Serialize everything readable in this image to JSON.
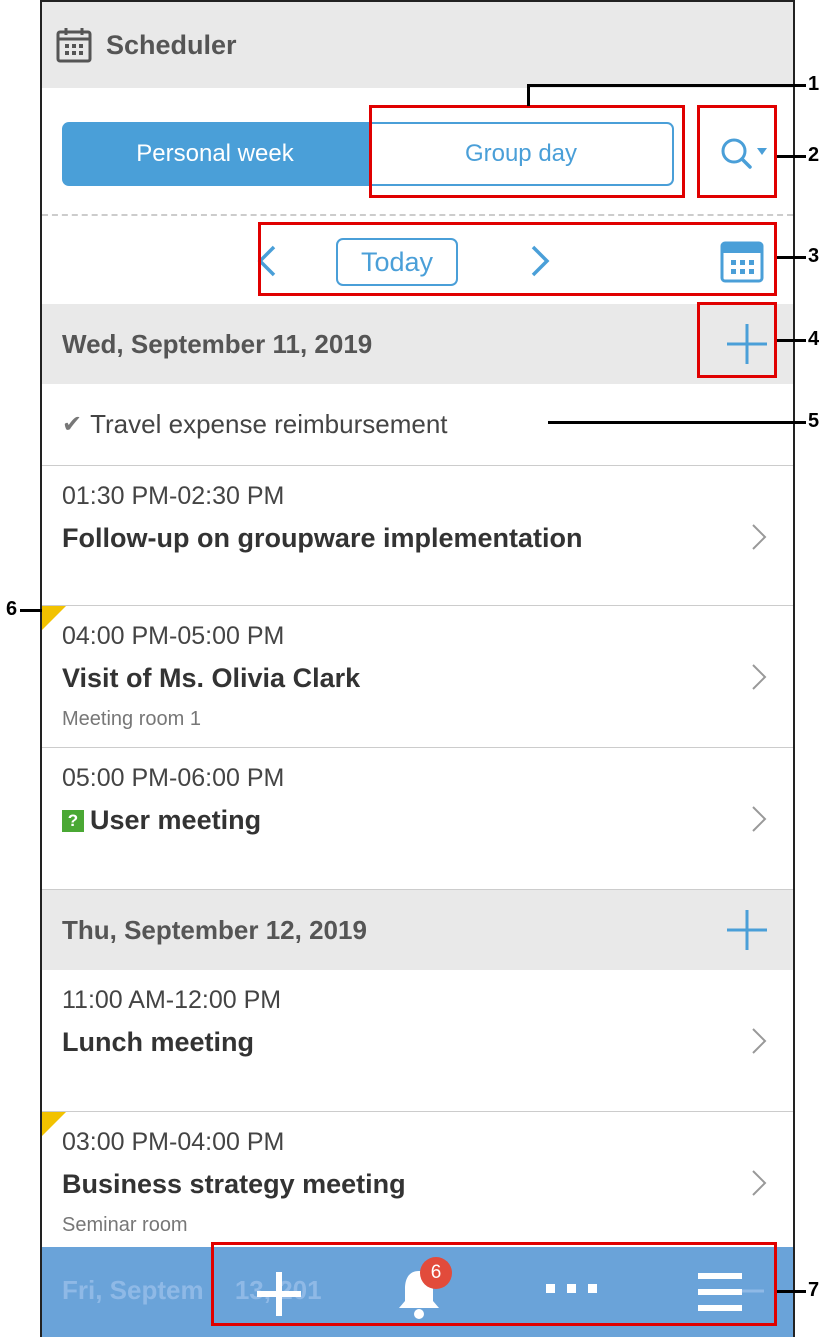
{
  "header": {
    "title": "Scheduler",
    "icon": "calendar-icon"
  },
  "tabs": {
    "personal_week": "Personal week",
    "group_day": "Group day"
  },
  "nav": {
    "today": "Today"
  },
  "days": [
    {
      "date": "Wed, September 11, 2019",
      "todo": "Travel expense reimbursement",
      "events": [
        {
          "time": "01:30 PM-02:30 PM",
          "title": "Follow-up on groupware implementation",
          "location": ""
        },
        {
          "time": "04:00 PM-05:00 PM",
          "title": "Visit of Ms. Olivia Clark",
          "location": "Meeting room 1"
        },
        {
          "time": "05:00 PM-06:00 PM",
          "title": "User meeting",
          "location": "",
          "tentative_mark": "?"
        }
      ]
    },
    {
      "date": "Thu, September 12, 2019",
      "events": [
        {
          "time": "11:00 AM-12:00 PM",
          "title": "Lunch meeting",
          "location": ""
        },
        {
          "time": "03:00 PM-04:00 PM",
          "title": "Business strategy meeting",
          "location": "Seminar room"
        }
      ]
    }
  ],
  "peek_date": "Fri, Septem",
  "peek_date_suffix": "13, 201",
  "bottom_bar": {
    "notification_count": "6"
  },
  "callouts": [
    "1",
    "2",
    "3",
    "4",
    "5",
    "6",
    "7"
  ],
  "colors": {
    "accent": "#4a9fd8",
    "bottom_bar": "#6aa3d9",
    "callout": "#e00000",
    "badge": "#e24b3b",
    "tentative": "#4aa834",
    "marker": "#f2c200"
  }
}
